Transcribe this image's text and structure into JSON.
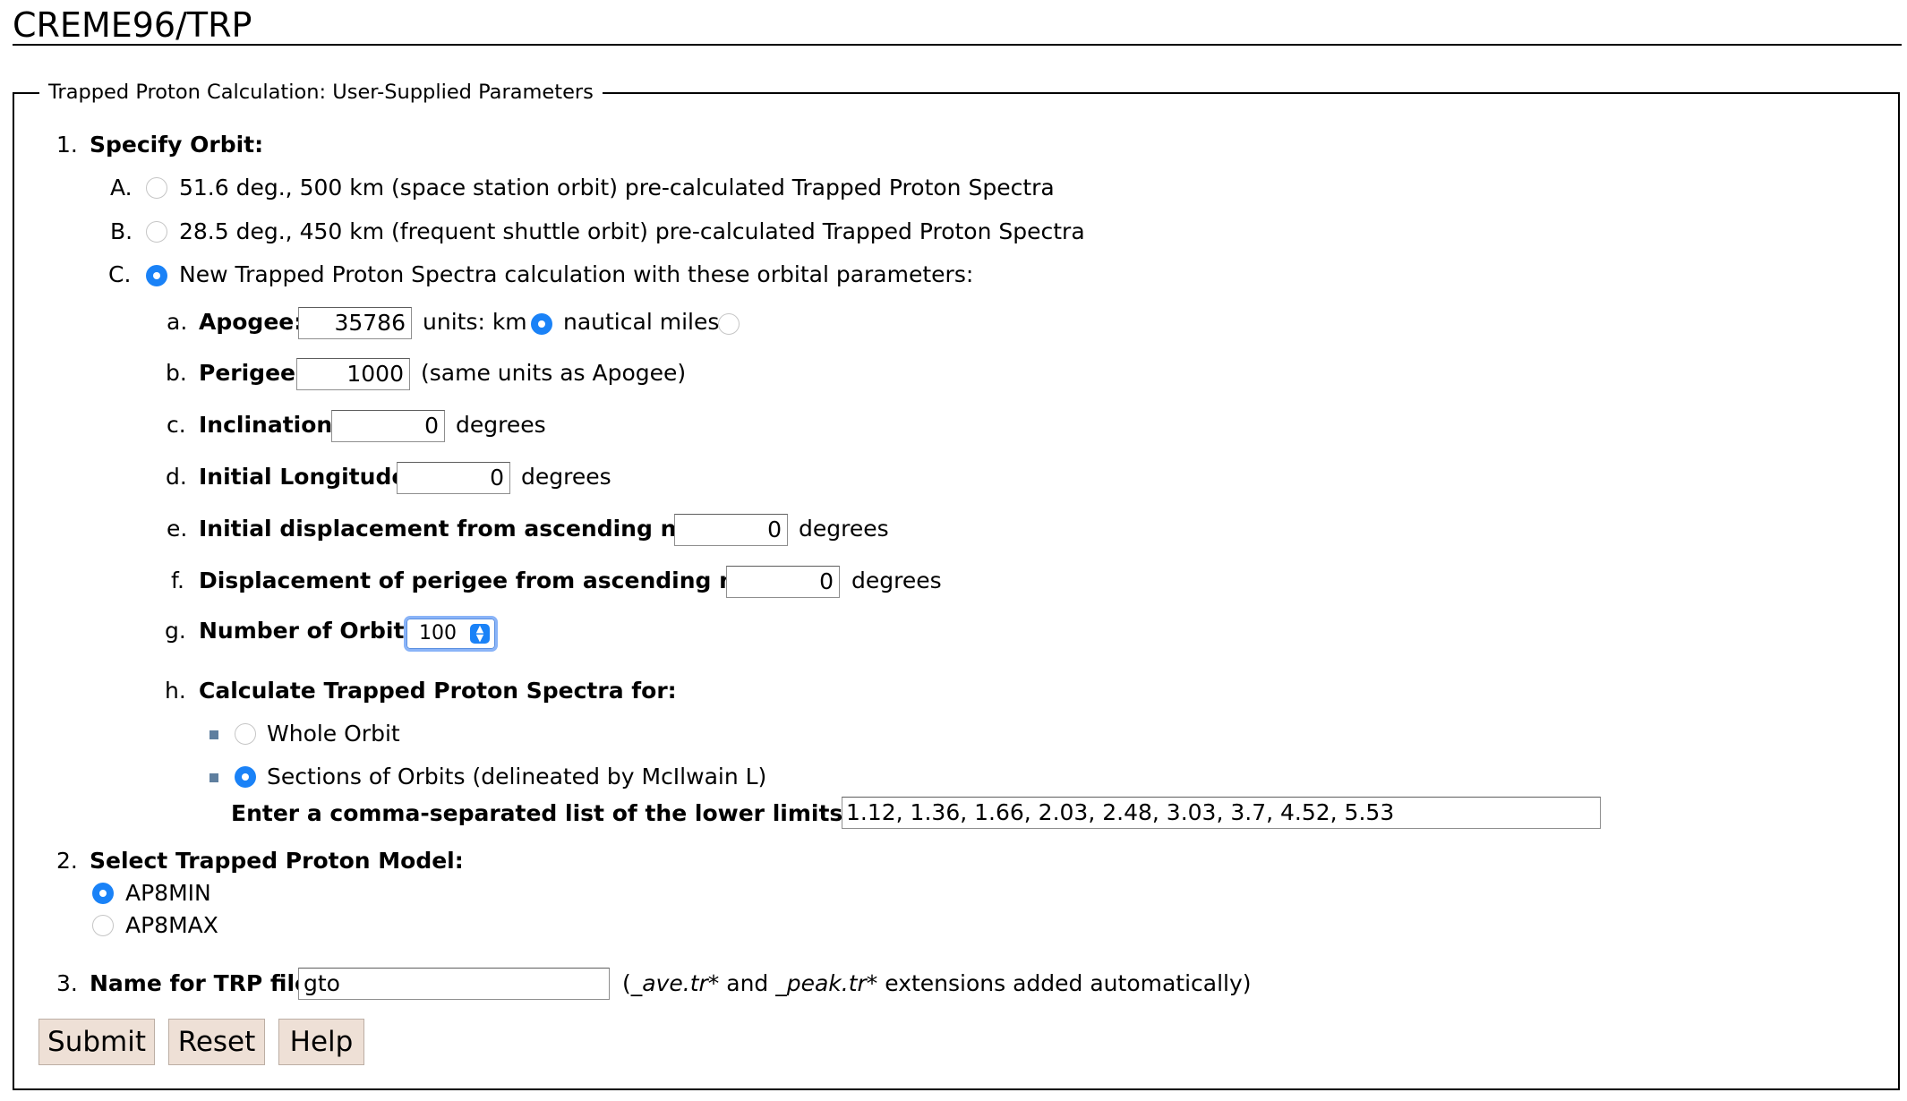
{
  "header": {
    "title": "CREME96/TRP"
  },
  "form": {
    "legend": "Trapped Proton Calculation: User-Supplied Parameters",
    "step1": {
      "num": "1.",
      "label": "Specify Orbit:",
      "options": [
        {
          "letter": "A.",
          "text": "51.6 deg., 500 km (space station orbit) pre-calculated Trapped Proton Spectra",
          "checked": false
        },
        {
          "letter": "B.",
          "text": "28.5 deg., 450 km (frequent shuttle orbit) pre-calculated Trapped Proton Spectra",
          "checked": false
        },
        {
          "letter": "C.",
          "text": "New Trapped Proton Spectra calculation with these orbital parameters:",
          "checked": true
        }
      ],
      "params": {
        "a": {
          "letter": "a.",
          "label": "Apogee:",
          "value": "35786",
          "units_prefix": "units: km",
          "nm_label": "nautical miles",
          "km_checked": true,
          "nm_checked": false
        },
        "b": {
          "letter": "b.",
          "label": "Perigee:",
          "value": "1000",
          "suffix": "(same units as Apogee)"
        },
        "c": {
          "letter": "c.",
          "label": "Inclination:",
          "value": "0",
          "suffix": "degrees"
        },
        "d": {
          "letter": "d.",
          "label": "Initial Longitude:",
          "value": "0",
          "suffix": "degrees"
        },
        "e": {
          "letter": "e.",
          "label": "Initial displacement from ascending node:",
          "value": "0",
          "suffix": "degrees"
        },
        "f": {
          "letter": "f.",
          "label": "Displacement of perigee from ascending node:",
          "value": "0",
          "suffix": "degrees"
        },
        "g": {
          "letter": "g.",
          "label": "Number of Orbits",
          "selected": "100"
        },
        "h": {
          "letter": "h.",
          "label": "Calculate Trapped Proton Spectra for:",
          "whole_orbit": "Whole Orbit",
          "sections": "Sections of Orbits (delineated by McIlwain L)",
          "sections_checked": true,
          "l_list_label": "Enter a comma-separated list of the lower limits on L:",
          "l_list_value": "1.12, 1.36, 1.66, 2.03, 2.48, 3.03, 3.7, 4.52, 5.53"
        }
      }
    },
    "step2": {
      "num": "2.",
      "label": "Select Trapped Proton Model:",
      "models": [
        {
          "name": "AP8MIN",
          "checked": true
        },
        {
          "name": "AP8MAX",
          "checked": false
        }
      ]
    },
    "step3": {
      "num": "3.",
      "label": "Name for TRP file:",
      "value": "gto",
      "note_open": "(",
      "ext1": "_ave.tr*",
      "note_and": " and ",
      "ext2": "_peak.tr*",
      "note_end": " extensions added automatically)"
    },
    "buttons": {
      "submit": "Submit",
      "reset": "Reset",
      "help": "Help"
    }
  },
  "colors": {
    "radio_accent": "#1a82f7",
    "button_bg": "#eee0d6"
  }
}
